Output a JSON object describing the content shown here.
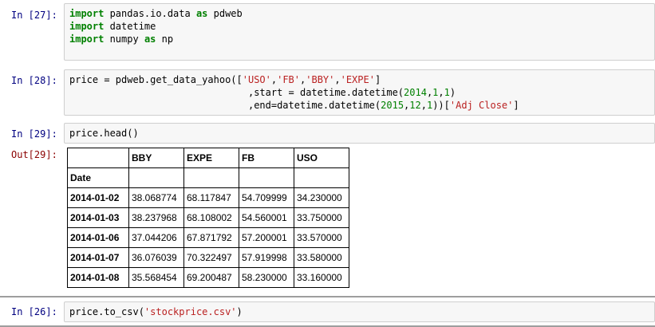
{
  "cells": [
    {
      "prompt": "In [27]:",
      "lines": [
        [
          {
            "t": "import",
            "k": "kw"
          },
          {
            "t": " pandas.io.data "
          },
          {
            "t": "as",
            "k": "kw"
          },
          {
            "t": " pdweb"
          }
        ],
        [
          {
            "t": "import",
            "k": "kw"
          },
          {
            "t": " datetime"
          }
        ],
        [
          {
            "t": "import",
            "k": "kw"
          },
          {
            "t": " numpy "
          },
          {
            "t": "as",
            "k": "kw"
          },
          {
            "t": " np"
          }
        ]
      ]
    },
    {
      "prompt": "In [28]:",
      "lines": [
        [
          {
            "t": "price = pdweb.get_data_yahoo(["
          },
          {
            "t": "'USO'",
            "k": "str"
          },
          {
            "t": ","
          },
          {
            "t": "'FB'",
            "k": "str"
          },
          {
            "t": ","
          },
          {
            "t": "'BBY'",
            "k": "str"
          },
          {
            "t": ","
          },
          {
            "t": "'EXPE'",
            "k": "str"
          },
          {
            "t": "]"
          }
        ],
        [
          {
            "t": "                               ,start = datetime.datetime("
          },
          {
            "t": "2014",
            "k": "num"
          },
          {
            "t": ","
          },
          {
            "t": "1",
            "k": "num"
          },
          {
            "t": ","
          },
          {
            "t": "1",
            "k": "num"
          },
          {
            "t": ")"
          }
        ],
        [
          {
            "t": "                               ,end=datetime.datetime("
          },
          {
            "t": "2015",
            "k": "num"
          },
          {
            "t": ","
          },
          {
            "t": "12",
            "k": "num"
          },
          {
            "t": ","
          },
          {
            "t": "1",
            "k": "num"
          },
          {
            "t": "))["
          },
          {
            "t": "'Adj Close'",
            "k": "str"
          },
          {
            "t": "]"
          }
        ]
      ]
    },
    {
      "prompt": "In [29]:",
      "lines": [
        [
          {
            "t": "price.head()"
          }
        ]
      ]
    },
    {
      "prompt": "In [26]:",
      "lines": [
        [
          {
            "t": "price.to_csv("
          },
          {
            "t": "'stockprice.csv'",
            "k": "str"
          },
          {
            "t": ")"
          }
        ]
      ]
    }
  ],
  "output": {
    "prompt": "Out[29]:",
    "columns": [
      "BBY",
      "EXPE",
      "FB",
      "USO"
    ],
    "index_name": "Date",
    "rows": [
      {
        "date": "2014-01-02",
        "values": [
          "38.068774",
          "68.117847",
          "54.709999",
          "34.230000"
        ]
      },
      {
        "date": "2014-01-03",
        "values": [
          "38.237968",
          "68.108002",
          "54.560001",
          "33.750000"
        ]
      },
      {
        "date": "2014-01-06",
        "values": [
          "37.044206",
          "67.871792",
          "57.200001",
          "33.570000"
        ]
      },
      {
        "date": "2014-01-07",
        "values": [
          "36.076039",
          "70.322497",
          "57.919998",
          "33.580000"
        ]
      },
      {
        "date": "2014-01-08",
        "values": [
          "35.568454",
          "69.200487",
          "58.230000",
          "33.160000"
        ]
      }
    ]
  }
}
